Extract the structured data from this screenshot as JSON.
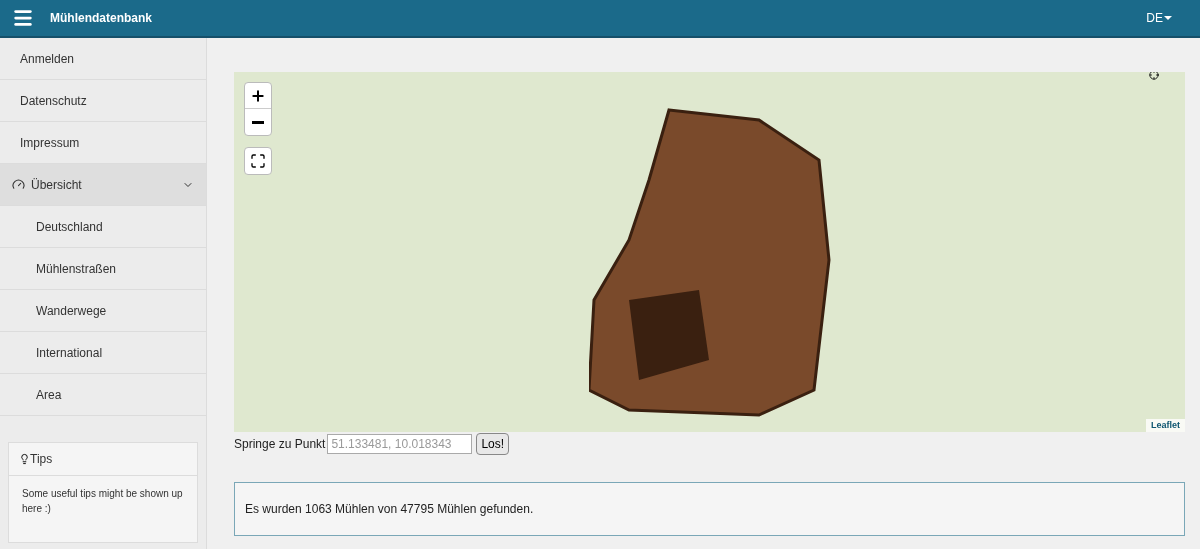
{
  "header": {
    "title": "Mühlendatenbank",
    "language": "DE"
  },
  "sidebar": {
    "items": [
      {
        "kind": "link",
        "label": "Anmelden"
      },
      {
        "kind": "link",
        "label": "Datenschutz"
      },
      {
        "kind": "link",
        "label": "Impressum"
      },
      {
        "kind": "group",
        "label": "Übersicht",
        "expanded": true,
        "children": [
          {
            "label": "Deutschland"
          },
          {
            "label": "Mühlenstraßen"
          },
          {
            "label": "Wanderwege"
          },
          {
            "label": "International"
          },
          {
            "label": "Area"
          }
        ]
      }
    ],
    "tips": {
      "title": "Tips",
      "text": "Some useful tips might be shown up here :)"
    }
  },
  "map": {
    "attribution": "Leaflet"
  },
  "jump": {
    "label": "Springe zu Punkt",
    "placeholder": "51.133481, 10.018343",
    "button": "Los!"
  },
  "result": "Es wurden 1063 Mühlen von 47795 Mühlen gefunden."
}
